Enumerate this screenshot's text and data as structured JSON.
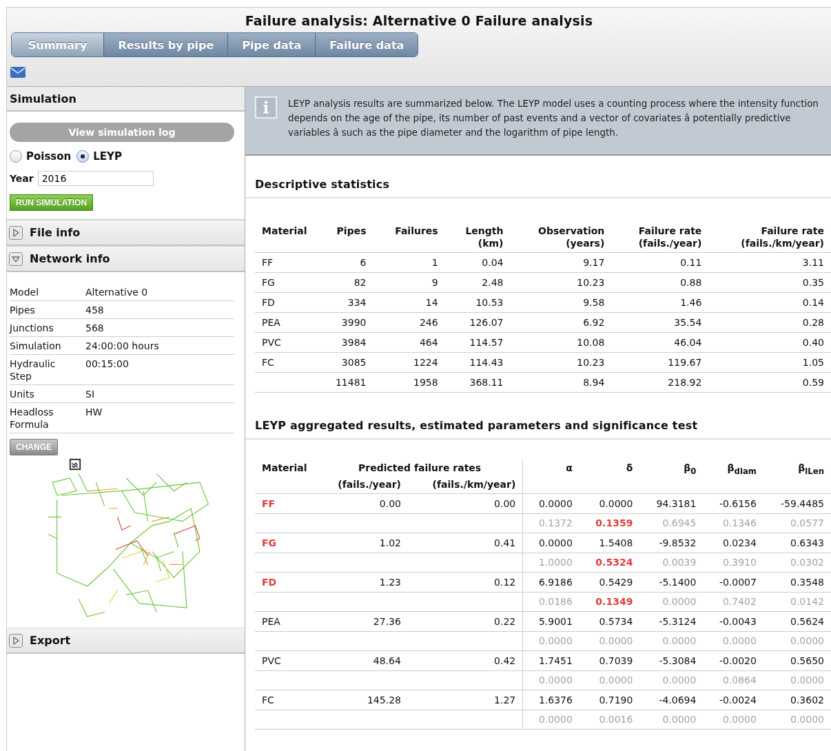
{
  "window": {
    "title": "Failure analysis: Alternative 0 Failure analysis"
  },
  "tabs": [
    {
      "label": "Summary",
      "selected": true
    },
    {
      "label": "Results by pipe",
      "selected": false
    },
    {
      "label": "Pipe data",
      "selected": false
    },
    {
      "label": "Failure data",
      "selected": false
    }
  ],
  "sidebar": {
    "simulation": {
      "title": "Simulation",
      "log_button": {
        "label": "View simulation log",
        "disabled": true
      },
      "models": [
        {
          "label": "Poisson",
          "selected": false
        },
        {
          "label": "LEYP",
          "selected": true
        }
      ],
      "year": {
        "label": "Year",
        "value": "2016"
      },
      "run_button": "RUN SIMULATION"
    },
    "sections": [
      {
        "title": "File info",
        "expanded": false
      },
      {
        "title": "Network info",
        "expanded": true,
        "rows": [
          {
            "label": "Model",
            "value": "Alternative 0"
          },
          {
            "label": "Pipes",
            "value": "458"
          },
          {
            "label": "Junctions",
            "value": "568"
          },
          {
            "label": "Simulation",
            "value": "24:00:00 hours"
          },
          {
            "label": "Hydraulic Step",
            "value": "00:15:00"
          },
          {
            "label": "Units",
            "value": "SI"
          },
          {
            "label": "Headloss Formula",
            "value": "HW"
          }
        ],
        "button": "CHANGE"
      },
      {
        "title": "Export",
        "expanded": false
      }
    ]
  },
  "info": "LEYP analysis results are summarized below. The LEYP model uses a counting process where the intensity function depends on the age of the pipe, its number of past events and a vector of covariates â potentially predictive variables â such as the pipe diameter and the logarithm of pipe length.",
  "descriptive": {
    "title": "Descriptive statistics",
    "columns": [
      {
        "label": "Material"
      },
      {
        "label": "Pipes"
      },
      {
        "label": "Failures"
      },
      {
        "label": "Length",
        "unit": "(km)"
      },
      {
        "label": "Observation",
        "unit": "(years)"
      },
      {
        "label": "Failure rate",
        "unit": "(fails./year)"
      },
      {
        "label": "Failure rate",
        "unit": "(fails./km/year)"
      }
    ],
    "rows": [
      [
        "FF",
        "6",
        "1",
        "0.04",
        "9.17",
        "0.11",
        "3.11"
      ],
      [
        "FG",
        "82",
        "9",
        "2.48",
        "10.23",
        "0.88",
        "0.35"
      ],
      [
        "FD",
        "334",
        "14",
        "10.53",
        "9.58",
        "1.46",
        "0.14"
      ],
      [
        "PEA",
        "3990",
        "246",
        "126.07",
        "6.92",
        "35.54",
        "0.28"
      ],
      [
        "PVC",
        "3984",
        "464",
        "114.57",
        "10.08",
        "46.04",
        "0.40"
      ],
      [
        "FC",
        "3085",
        "1224",
        "114.43",
        "10.23",
        "119.67",
        "1.05"
      ],
      [
        "",
        "11481",
        "1958",
        "368.11",
        "8.94",
        "218.92",
        "0.59"
      ]
    ]
  },
  "leyp": {
    "title": "LEYP aggregated results, estimated parameters and significance test",
    "material_header": "Material",
    "rates_header": "Predicted failure rates",
    "rate_units": [
      "(fails./year)",
      "(fails./km/year)"
    ],
    "params": [
      "α",
      "δ",
      "β$_{0}$",
      "β$_{diam}$",
      "β$_{lLen}$"
    ],
    "rows": [
      {
        "material": "FF",
        "flagged": true,
        "rates": [
          "0.00",
          "0.00"
        ],
        "estimates": [
          "0.0000",
          "0.0000",
          "94.3181",
          "-0.6156",
          "-59.4485"
        ],
        "pvalues": [
          {
            "value": "0.1372",
            "significant": false
          },
          {
            "value": "0.1359",
            "significant": true
          },
          {
            "value": "0.6945",
            "significant": false
          },
          {
            "value": "0.1346",
            "significant": false
          },
          {
            "value": "0.0577",
            "significant": false
          }
        ]
      },
      {
        "material": "FG",
        "flagged": true,
        "rates": [
          "1.02",
          "0.41"
        ],
        "estimates": [
          "0.0000",
          "1.5408",
          "-9.8532",
          "0.0234",
          "0.6343"
        ],
        "pvalues": [
          {
            "value": "1.0000",
            "significant": false
          },
          {
            "value": "0.5324",
            "significant": true
          },
          {
            "value": "0.0039",
            "significant": false
          },
          {
            "value": "0.3910",
            "significant": false
          },
          {
            "value": "0.0302",
            "significant": false
          }
        ]
      },
      {
        "material": "FD",
        "flagged": true,
        "rates": [
          "1.23",
          "0.12"
        ],
        "estimates": [
          "6.9186",
          "0.5429",
          "-5.1400",
          "-0.0007",
          "0.3548"
        ],
        "pvalues": [
          {
            "value": "0.0186",
            "significant": false
          },
          {
            "value": "0.1349",
            "significant": true
          },
          {
            "value": "0.0000",
            "significant": false
          },
          {
            "value": "0.7402",
            "significant": false
          },
          {
            "value": "0.0142",
            "significant": false
          }
        ]
      },
      {
        "material": "PEA",
        "flagged": false,
        "rates": [
          "27.36",
          "0.22"
        ],
        "estimates": [
          "5.9001",
          "0.5734",
          "-5.3124",
          "-0.0043",
          "0.5624"
        ],
        "pvalues": [
          {
            "value": "0.0000",
            "significant": false
          },
          {
            "value": "0.0000",
            "significant": false
          },
          {
            "value": "0.0000",
            "significant": false
          },
          {
            "value": "0.0000",
            "significant": false
          },
          {
            "value": "0.0000",
            "significant": false
          }
        ]
      },
      {
        "material": "PVC",
        "flagged": false,
        "rates": [
          "48.64",
          "0.42"
        ],
        "estimates": [
          "1.7451",
          "0.7039",
          "-5.3084",
          "-0.0020",
          "0.5650"
        ],
        "pvalues": [
          {
            "value": "0.0000",
            "significant": false
          },
          {
            "value": "0.0000",
            "significant": false
          },
          {
            "value": "0.0000",
            "significant": false
          },
          {
            "value": "0.0864",
            "significant": false
          },
          {
            "value": "0.0000",
            "significant": false
          }
        ]
      },
      {
        "material": "FC",
        "flagged": false,
        "rates": [
          "145.28",
          "1.27"
        ],
        "estimates": [
          "1.6376",
          "0.7190",
          "-4.0694",
          "-0.0024",
          "0.3602"
        ],
        "pvalues": [
          {
            "value": "0.0000",
            "significant": false
          },
          {
            "value": "0.0016",
            "significant": false
          },
          {
            "value": "0.0000",
            "significant": false
          },
          {
            "value": "0.0000",
            "significant": false
          },
          {
            "value": "0.0000",
            "significant": false
          }
        ]
      }
    ]
  }
}
